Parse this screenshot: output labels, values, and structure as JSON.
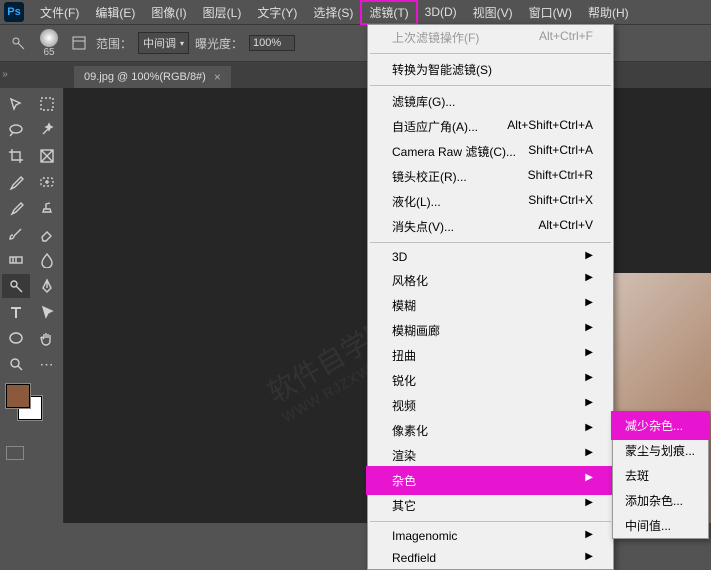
{
  "app": {
    "logo": "Ps"
  },
  "menu": {
    "items": [
      "文件(F)",
      "编辑(E)",
      "图像(I)",
      "图层(L)",
      "文字(Y)",
      "选择(S)",
      "滤镜(T)",
      "3D(D)",
      "视图(V)",
      "窗口(W)",
      "帮助(H)"
    ],
    "active_index": 6
  },
  "options": {
    "brush_size": "65",
    "range_label": "范围：",
    "range_value": "中间调",
    "exposure_label": "曝光度：",
    "exposure_value": "100%"
  },
  "tab": {
    "title": "09.jpg @ 100%(RGB/8#)",
    "close": "×"
  },
  "swatch": {
    "fg": "#8b5a3c",
    "bg": "#ffffff"
  },
  "watermark": {
    "main": "软件自学网",
    "sub": "WWW.RJZXW.COM"
  },
  "dropdown": {
    "sec1": [
      {
        "label": "上次滤镜操作(F)",
        "shortcut": "Alt+Ctrl+F",
        "disabled": true
      }
    ],
    "sec2": [
      {
        "label": "转换为智能滤镜(S)",
        "shortcut": ""
      }
    ],
    "sec3": [
      {
        "label": "滤镜库(G)...",
        "shortcut": ""
      },
      {
        "label": "自适应广角(A)...",
        "shortcut": "Alt+Shift+Ctrl+A"
      },
      {
        "label": "Camera Raw 滤镜(C)...",
        "shortcut": "Shift+Ctrl+A"
      },
      {
        "label": "镜头校正(R)...",
        "shortcut": "Shift+Ctrl+R"
      },
      {
        "label": "液化(L)...",
        "shortcut": "Shift+Ctrl+X"
      },
      {
        "label": "消失点(V)...",
        "shortcut": "Alt+Ctrl+V"
      }
    ],
    "sec4": [
      {
        "label": "3D",
        "sub": true
      },
      {
        "label": "风格化",
        "sub": true
      },
      {
        "label": "模糊",
        "sub": true
      },
      {
        "label": "模糊画廊",
        "sub": true
      },
      {
        "label": "扭曲",
        "sub": true
      },
      {
        "label": "锐化",
        "sub": true
      },
      {
        "label": "视频",
        "sub": true
      },
      {
        "label": "像素化",
        "sub": true
      },
      {
        "label": "渲染",
        "sub": true
      },
      {
        "label": "杂色",
        "sub": true,
        "hl": true
      },
      {
        "label": "其它",
        "sub": true
      }
    ],
    "sec5": [
      {
        "label": "Imagenomic",
        "sub": true
      },
      {
        "label": "Redfield",
        "sub": true
      }
    ]
  },
  "submenu": {
    "items": [
      {
        "label": "减少杂色...",
        "hl": true
      },
      {
        "label": "蒙尘与划痕...",
        "hl": false
      },
      {
        "label": "去斑",
        "hl": false
      },
      {
        "label": "添加杂色...",
        "hl": false
      },
      {
        "label": "中间值...",
        "hl": false
      }
    ]
  }
}
